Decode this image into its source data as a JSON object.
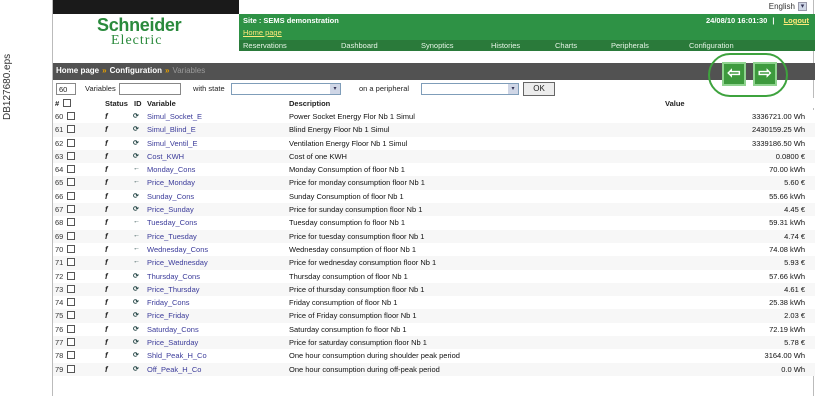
{
  "side_ref": "DB127680.eps",
  "lang": {
    "label": "English",
    "chev": "▾"
  },
  "logo": {
    "line1": "Schneider",
    "line2": "Electric"
  },
  "site": {
    "label": "Site : SEMS demonstration",
    "home": "Home page"
  },
  "datetime": "24/08/10 16:01:30",
  "logout": "Logout",
  "menu": [
    {
      "label": "Reservations"
    },
    {
      "label": "Dashboard"
    },
    {
      "label": "Synoptics"
    },
    {
      "label": "Histories"
    },
    {
      "label": "Charts"
    },
    {
      "label": "Peripherals"
    },
    {
      "label": "Configuration"
    }
  ],
  "breadcrumb": {
    "home": "Home page",
    "sep": "»",
    "config": "Configuration",
    "current": "Variables"
  },
  "nav": {
    "prev": "⇦",
    "next": "⇨"
  },
  "filter": {
    "count": "60",
    "variables_label": "Variables",
    "with_state_label": "with state",
    "peripheral_label": "on a peripheral",
    "ok": "OK",
    "chev": "▾"
  },
  "table": {
    "headers": {
      "num": "#",
      "status": "Status",
      "id": "ID",
      "variable": "Variable",
      "description": "Description",
      "value": "Value"
    },
    "rows": [
      {
        "num": "60",
        "status": "f",
        "var_icon": "⟳",
        "variable": "Simul_Socket_E",
        "description": "Power Socket Energy Flor Nb 1 Simul",
        "value": "3336721.00 Wh"
      },
      {
        "num": "61",
        "status": "f",
        "var_icon": "⟳",
        "variable": "Simul_Blind_E",
        "description": "Blind Energy Floor Nb 1 Simul",
        "value": "2430159.25 Wh"
      },
      {
        "num": "62",
        "status": "f",
        "var_icon": "⟳",
        "variable": "Simul_Ventil_E",
        "description": "Ventilation Energy Floor Nb 1 Simul",
        "value": "3339186.50 Wh"
      },
      {
        "num": "63",
        "status": "f",
        "var_icon": "⟳",
        "variable": "Cost_KWH",
        "description": "Cost of one KWH",
        "value": "0.0800 €"
      },
      {
        "num": "64",
        "status": "f",
        "var_icon": "←",
        "variable": "Monday_Cons",
        "description": "Monday Consumption of floor Nb 1",
        "value": "70.00 kWh"
      },
      {
        "num": "65",
        "status": "f",
        "var_icon": "←",
        "variable": "Price_Monday",
        "description": "Price for monday consumption floor Nb 1",
        "value": "5.60 €"
      },
      {
        "num": "66",
        "status": "f",
        "var_icon": "⟳",
        "variable": "Sunday_Cons",
        "description": "Sunday Consumption of floor Nb 1",
        "value": "55.66 kWh"
      },
      {
        "num": "67",
        "status": "f",
        "var_icon": "⟳",
        "variable": "Price_Sunday",
        "description": "Price for sunday consumption floor Nb 1",
        "value": "4.45 €"
      },
      {
        "num": "68",
        "status": "f",
        "var_icon": "←",
        "variable": "Tuesday_Cons",
        "description": "Tuesday consumption fo floor Nb 1",
        "value": "59.31 kWh"
      },
      {
        "num": "69",
        "status": "f",
        "var_icon": "←",
        "variable": "Price_Tuesday",
        "description": "Price for tuesday consumption floor Nb 1",
        "value": "4.74 €"
      },
      {
        "num": "70",
        "status": "f",
        "var_icon": "←",
        "variable": "Wednesday_Cons",
        "description": "Wednesday consumption of floor Nb 1",
        "value": "74.08 kWh"
      },
      {
        "num": "71",
        "status": "f",
        "var_icon": "←",
        "variable": "Price_Wednesday",
        "description": "Price for wednesday consumption floor Nb 1",
        "value": "5.93 €"
      },
      {
        "num": "72",
        "status": "f",
        "var_icon": "⟳",
        "variable": "Thursday_Cons",
        "description": "Thursday consumption of floor Nb 1",
        "value": "57.66 kWh"
      },
      {
        "num": "73",
        "status": "f",
        "var_icon": "⟳",
        "variable": "Price_Thursday",
        "description": "Price of thursday consumption floor Nb 1",
        "value": "4.61 €"
      },
      {
        "num": "74",
        "status": "f",
        "var_icon": "⟳",
        "variable": "Friday_Cons",
        "description": "Friday consumption of floor Nb 1",
        "value": "25.38 kWh"
      },
      {
        "num": "75",
        "status": "f",
        "var_icon": "⟳",
        "variable": "Price_Friday",
        "description": "Price of Friday consumption floor Nb 1",
        "value": "2.03 €"
      },
      {
        "num": "76",
        "status": "f",
        "var_icon": "⟳",
        "variable": "Saturday_Cons",
        "description": "Saturday consumption fo floor Nb 1",
        "value": "72.19 kWh"
      },
      {
        "num": "77",
        "status": "f",
        "var_icon": "⟳",
        "variable": "Price_Saturday",
        "description": "Price for saturday consumption floor Nb 1",
        "value": "5.78 €"
      },
      {
        "num": "78",
        "status": "f",
        "var_icon": "⟳",
        "variable": "Shld_Peak_H_Co",
        "description": "One hour consumption during shoulder peak period",
        "value": "3164.00 Wh"
      },
      {
        "num": "79",
        "status": "f",
        "var_icon": "⟳",
        "variable": "Off_Peak_H_Co",
        "description": "One hour consumption during off-peak period",
        "value": "0.0 Wh"
      }
    ]
  },
  "colors": {
    "brand_green": "#2e9245",
    "menu_green": "#2a7a3a",
    "crumb_bar": "#525252",
    "link_blue": "#3b3b9a"
  }
}
